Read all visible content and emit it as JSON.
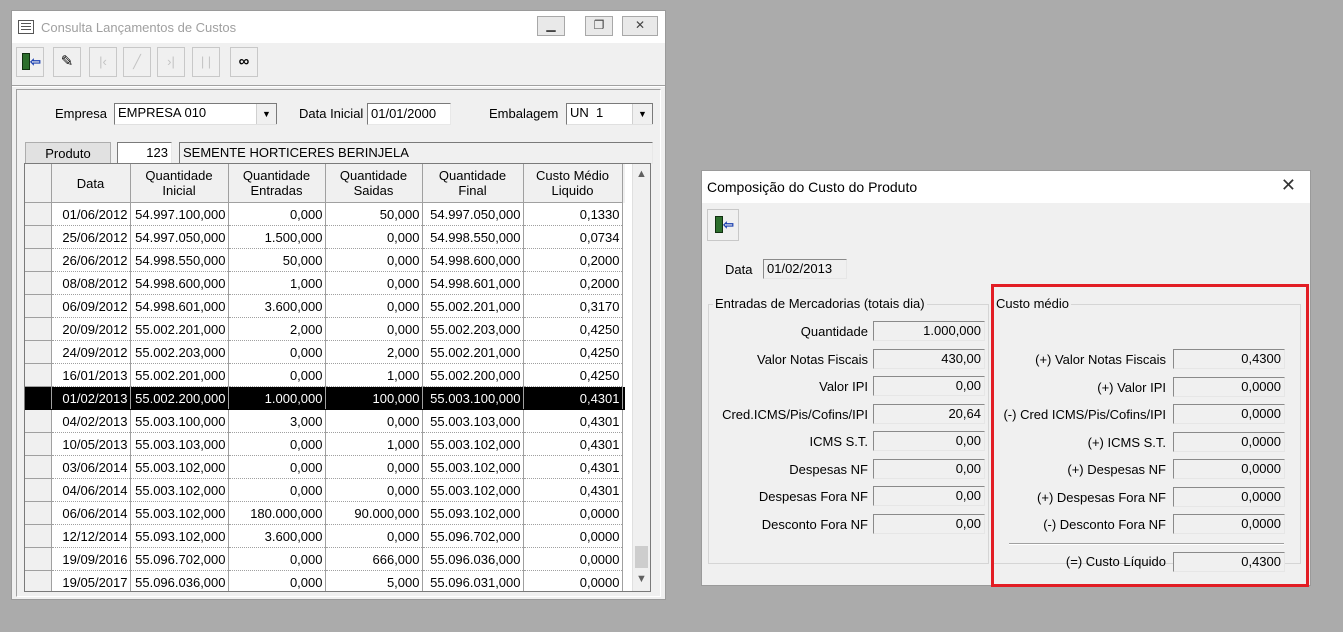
{
  "window1": {
    "title": "Consulta Lançamentos de Custos",
    "toolbar": {
      "exit_icon": "door-exit-icon",
      "eraser_icon": "eraser-icon",
      "first_icon": "first-record-icon",
      "edit_icon": "edit-icon",
      "last_icon": "last-record-icon",
      "pause_icon": "pause-icon",
      "search_icon": "binoculars-icon"
    },
    "empresa_label": "Empresa",
    "empresa_value": "EMPRESA 010",
    "data_inicial_label": "Data Inicial",
    "data_inicial_value": "01/01/2000",
    "embalagem_label": "Embalagem",
    "embalagem_value": "UN  1",
    "produto_button": "Produto",
    "produto_code": "123",
    "produto_name": "SEMENTE HORTICERES BERINJELA",
    "grid": {
      "headers": [
        {
          "l1": "Data",
          "l2": ""
        },
        {
          "l1": "Quantidade",
          "l2": "Inicial"
        },
        {
          "l1": "Quantidade",
          "l2": "Entradas"
        },
        {
          "l1": "Quantidade",
          "l2": "Saidas"
        },
        {
          "l1": "Quantidade",
          "l2": "Final"
        },
        {
          "l1": "Custo Médio",
          "l2": "Liquido"
        }
      ],
      "selected_row_index": 8,
      "rows": [
        [
          "01/06/2012",
          "54.997.100,000",
          "0,000",
          "50,000",
          "54.997.050,000",
          "0,1330"
        ],
        [
          "25/06/2012",
          "54.997.050,000",
          "1.500,000",
          "0,000",
          "54.998.550,000",
          "0,0734"
        ],
        [
          "26/06/2012",
          "54.998.550,000",
          "50,000",
          "0,000",
          "54.998.600,000",
          "0,2000"
        ],
        [
          "08/08/2012",
          "54.998.600,000",
          "1,000",
          "0,000",
          "54.998.601,000",
          "0,2000"
        ],
        [
          "06/09/2012",
          "54.998.601,000",
          "3.600,000",
          "0,000",
          "55.002.201,000",
          "0,3170"
        ],
        [
          "20/09/2012",
          "55.002.201,000",
          "2,000",
          "0,000",
          "55.002.203,000",
          "0,4250"
        ],
        [
          "24/09/2012",
          "55.002.203,000",
          "0,000",
          "2,000",
          "55.002.201,000",
          "0,4250"
        ],
        [
          "16/01/2013",
          "55.002.201,000",
          "0,000",
          "1,000",
          "55.002.200,000",
          "0,4250"
        ],
        [
          "01/02/2013",
          "55.002.200,000",
          "1.000,000",
          "100,000",
          "55.003.100,000",
          "0,4301"
        ],
        [
          "04/02/2013",
          "55.003.100,000",
          "3,000",
          "0,000",
          "55.003.103,000",
          "0,4301"
        ],
        [
          "10/05/2013",
          "55.003.103,000",
          "0,000",
          "1,000",
          "55.003.102,000",
          "0,4301"
        ],
        [
          "03/06/2014",
          "55.003.102,000",
          "0,000",
          "0,000",
          "55.003.102,000",
          "0,4301"
        ],
        [
          "04/06/2014",
          "55.003.102,000",
          "0,000",
          "0,000",
          "55.003.102,000",
          "0,4301"
        ],
        [
          "06/06/2014",
          "55.003.102,000",
          "180.000,000",
          "90.000,000",
          "55.093.102,000",
          "0,0000"
        ],
        [
          "12/12/2014",
          "55.093.102,000",
          "3.600,000",
          "0,000",
          "55.096.702,000",
          "0,0000"
        ],
        [
          "19/09/2016",
          "55.096.702,000",
          "0,000",
          "666,000",
          "55.096.036,000",
          "0,0000"
        ],
        [
          "19/05/2017",
          "55.096.036,000",
          "0,000",
          "5,000",
          "55.096.031,000",
          "0,0000"
        ]
      ]
    }
  },
  "window2": {
    "title": "Composição do Custo do Produto",
    "close_glyph": "✕",
    "data_label": "Data",
    "data_value": "01/02/2013",
    "entradas": {
      "title": "Entradas de Mercadorias (totais dia)",
      "rows": [
        {
          "label": "Quantidade",
          "value": "1.000,000"
        },
        {
          "label": "Valor Notas Fiscais",
          "value": "430,00"
        },
        {
          "label": "Valor IPI",
          "value": "0,00"
        },
        {
          "label": "Cred.ICMS/Pis/Cofins/IPI",
          "value": "20,64"
        },
        {
          "label": "ICMS S.T.",
          "value": "0,00"
        },
        {
          "label": "Despesas NF",
          "value": "0,00"
        },
        {
          "label": "Despesas Fora NF",
          "value": "0,00"
        },
        {
          "label": "Desconto Fora NF",
          "value": "0,00"
        }
      ]
    },
    "custo_medio": {
      "title": "Custo médio",
      "rows": [
        {
          "label": "(+) Valor Notas Fiscais",
          "value": "0,4300"
        },
        {
          "label": "(+) Valor IPI",
          "value": "0,0000"
        },
        {
          "label": "(-) Cred ICMS/Pis/Cofins/IPI",
          "value": "0,0000"
        },
        {
          "label": "(+) ICMS S.T.",
          "value": "0,0000"
        },
        {
          "label": "(+) Despesas NF",
          "value": "0,0000"
        },
        {
          "label": "(+) Despesas Fora NF",
          "value": "0,0000"
        },
        {
          "label": "(-) Desconto Fora NF",
          "value": "0,0000"
        }
      ],
      "total_label": "(=) Custo Líquido",
      "total_value": "0,4300"
    },
    "highlight_color": "#e21d24"
  }
}
